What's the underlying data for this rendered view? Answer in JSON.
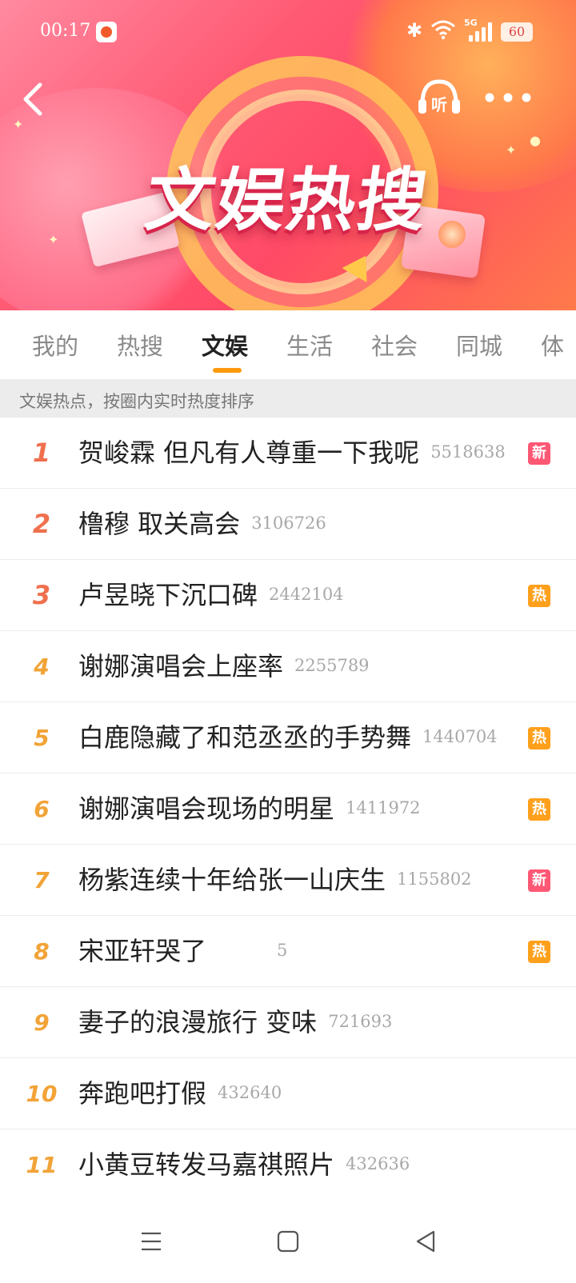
{
  "status_bar": {
    "time": "00:17",
    "network": "5G",
    "battery": "60"
  },
  "banner": {
    "title": "文娱热搜",
    "listen_label": "听"
  },
  "tabs": [
    {
      "label": "我的",
      "active": false
    },
    {
      "label": "热搜",
      "active": false
    },
    {
      "label": "文娱",
      "active": true
    },
    {
      "label": "生活",
      "active": false
    },
    {
      "label": "社会",
      "active": false
    },
    {
      "label": "同城",
      "active": false
    },
    {
      "label": "体",
      "active": false
    }
  ],
  "hint": "文娱热点，按圈内实时热度排序",
  "list": [
    {
      "rank": "1",
      "title": "贺峻霖 但凡有人尊重一下我呢",
      "count": "5518638",
      "badge": "新"
    },
    {
      "rank": "2",
      "title": "橹穆 取关高会",
      "count": "3106726",
      "badge": ""
    },
    {
      "rank": "3",
      "title": "卢昱晓下沉口碑",
      "count": "2442104",
      "badge": "热"
    },
    {
      "rank": "4",
      "title": "谢娜演唱会上座率",
      "count": "2255789",
      "badge": ""
    },
    {
      "rank": "5",
      "title": "白鹿隐藏了和范丞丞的手势舞",
      "count": "1440704",
      "badge": "热"
    },
    {
      "rank": "6",
      "title": "谢娜演唱会现场的明星",
      "count": "1411972",
      "badge": "热"
    },
    {
      "rank": "7",
      "title": "杨紫连续十年给张一山庆生",
      "count": "1155802",
      "badge": "新"
    },
    {
      "rank": "8",
      "title": "宋亚轩哭了",
      "count": "5",
      "badge": "热"
    },
    {
      "rank": "9",
      "title": "妻子的浪漫旅行 变味",
      "count": "721693",
      "badge": ""
    },
    {
      "rank": "10",
      "title": "奔跑吧打假",
      "count": "432640",
      "badge": ""
    },
    {
      "rank": "11",
      "title": "小黄豆转发马嘉祺照片",
      "count": "432636",
      "badge": ""
    }
  ],
  "colors": {
    "top_rank": "#f0704e",
    "rank": "#f2a337",
    "new_badge": "#ff5874",
    "hot_badge": "#ffa01c",
    "tab_indicator": "#ff9a0e"
  },
  "icons": {
    "back": "chevron-left-icon",
    "listen": "headphones-icon",
    "more": "more-dots-icon",
    "nav_menu": "menu-icon",
    "nav_home": "square-home-icon",
    "nav_back": "triangle-back-icon"
  }
}
